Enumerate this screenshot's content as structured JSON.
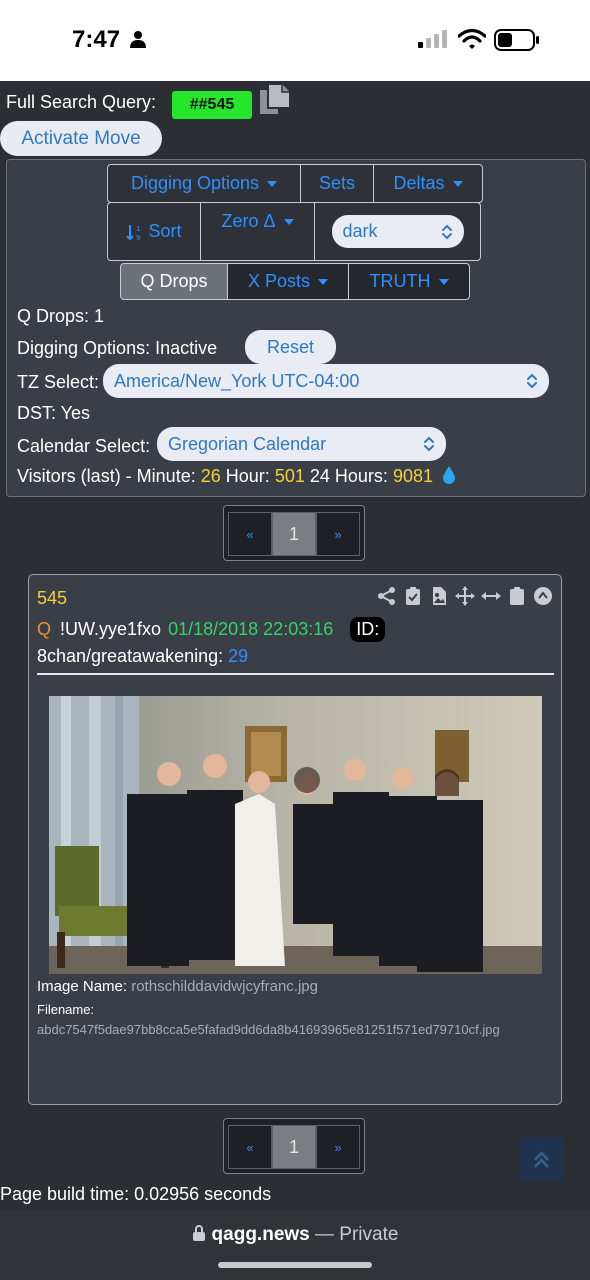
{
  "status": {
    "time": "7:47"
  },
  "query": {
    "label": "Full Search Query:",
    "value": "##545"
  },
  "activate_move": "Activate Move",
  "panel": {
    "digging_options": "Digging Options",
    "sets": "Sets",
    "deltas": "Deltas",
    "sort": "Sort",
    "zero_delta": "Zero Δ",
    "theme_select": "dark",
    "q_drops_tab": "Q Drops",
    "x_posts": "X Posts",
    "truth": "TRUTH",
    "q_drops_count_label": "Q Drops: 1",
    "digging_status": "Digging Options: Inactive",
    "reset": "Reset",
    "tz_label": "TZ Select:",
    "tz_value": "America/New_York UTC-04:00",
    "dst": "DST: Yes",
    "calendar_label": "Calendar Select:",
    "calendar_value": "Gregorian Calendar",
    "visitors_label": "Visitors (last) - Minute:",
    "visitors_minute": "26",
    "hour_label": "Hour:",
    "visitors_hour": "501",
    "day_label": "24 Hours:",
    "visitors_day": "9081"
  },
  "pager": {
    "prev": "«",
    "current": "1",
    "next": "»"
  },
  "post": {
    "number": "545",
    "author": "Q",
    "tripcode": "!UW.yye1fxo",
    "date": "01/18/2018 22:03:16",
    "id_badge": "ID:",
    "board": "8chan/greatawakening:",
    "thread": "29",
    "image_name_label": "Image Name:",
    "image_name": "rothschilddavidwjcyfranc.jpg",
    "filename_label": "Filename:",
    "filename": "abdc7547f5dae97bb8cca5e5fafad9dd6da8b41693965e81251f571ed79710cf.jpg"
  },
  "footer": {
    "build_time": "Page build time: 0.02956 seconds",
    "url": "qagg.news",
    "separator": " — ",
    "private": "Private"
  },
  "colors": {
    "accent": "#2f8fff",
    "highlight": "#25e62b",
    "yellow": "#f3d13a",
    "green": "#34d46b"
  }
}
